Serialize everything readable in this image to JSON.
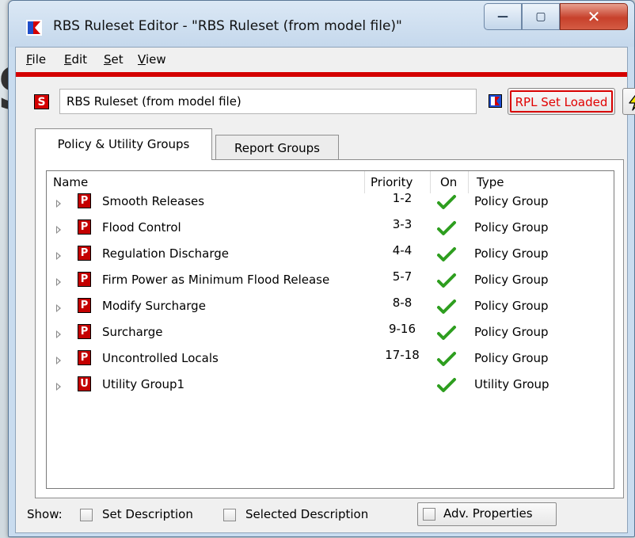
{
  "window": {
    "title": "RBS Ruleset Editor - \"RBS Ruleset (from model file)\"",
    "buttons": {
      "minimize": "—",
      "maximize": "▢",
      "close": "✕"
    }
  },
  "background_letter": "S",
  "menu": {
    "items": [
      {
        "underlined": "F",
        "rest": "ile"
      },
      {
        "underlined": "E",
        "rest": "dit"
      },
      {
        "underlined": "S",
        "rest": "et"
      },
      {
        "underlined": "V",
        "rest": "iew"
      }
    ]
  },
  "ruleset": {
    "icon_letter": "S",
    "name": "RBS Ruleset (from model file)",
    "rpl_button": "RPL Set Loaded"
  },
  "tabs": [
    {
      "label": "Policy & Utility Groups",
      "active": true
    },
    {
      "label": "Report Groups",
      "active": false
    }
  ],
  "table": {
    "columns": {
      "name": "Name",
      "priority": "Priority",
      "on": "On",
      "type": "Type"
    },
    "rows": [
      {
        "icon": "P",
        "name": "Smooth Releases",
        "priority": "1-2",
        "on": true,
        "type": "Policy Group"
      },
      {
        "icon": "P",
        "name": "Flood Control",
        "priority": "3-3",
        "on": true,
        "type": "Policy Group"
      },
      {
        "icon": "P",
        "name": "Regulation Discharge",
        "priority": "4-4",
        "on": true,
        "type": "Policy Group"
      },
      {
        "icon": "P",
        "name": "Firm Power as Minimum Flood Release",
        "priority": "5-7",
        "on": true,
        "type": "Policy Group"
      },
      {
        "icon": "P",
        "name": "Modify Surcharge",
        "priority": "8-8",
        "on": true,
        "type": "Policy Group"
      },
      {
        "icon": "P",
        "name": "Surcharge",
        "priority": "9-16",
        "on": true,
        "type": "Policy Group"
      },
      {
        "icon": "P",
        "name": "Uncontrolled Locals",
        "priority": "17-18",
        "on": true,
        "type": "Policy Group"
      },
      {
        "icon": "U",
        "name": "Utility Group1",
        "priority": "",
        "on": true,
        "type": "Utility Group"
      }
    ]
  },
  "show": {
    "label": "Show:",
    "options": [
      {
        "label": "Set Description",
        "checked": false
      },
      {
        "label": "Selected Description",
        "checked": false
      },
      {
        "label": "Adv. Properties",
        "checked": false
      }
    ]
  },
  "colors": {
    "accent_red": "#d40000",
    "check_green": "#2e9e1f",
    "rpl_red": "#e00000"
  }
}
